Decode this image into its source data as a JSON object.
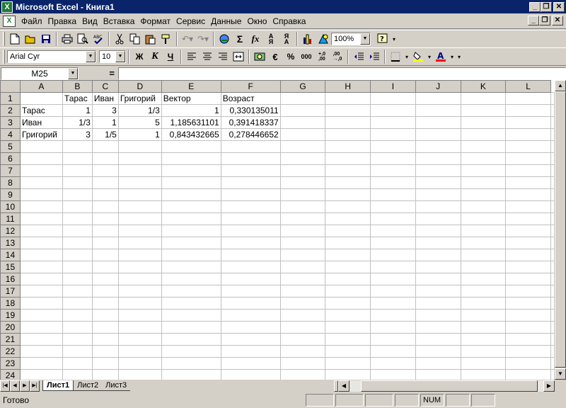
{
  "window": {
    "title": "Microsoft Excel - Книга1",
    "app_icon": "excel-icon",
    "minimize": "_",
    "restore": "❐",
    "close": "✕"
  },
  "menu": {
    "items": [
      "Файл",
      "Правка",
      "Вид",
      "Вставка",
      "Формат",
      "Сервис",
      "Данные",
      "Окно",
      "Справка"
    ]
  },
  "toolbar": {
    "zoom": "100%",
    "font_name": "Arial Cyr",
    "font_size": "10",
    "bold_label": "Ж",
    "italic_label": "К",
    "underline_label": "Ч",
    "percent_label": "%",
    "thousands_label": "000",
    "inc_decimal_label": "+,0 ,00",
    "dec_decimal_label": "→,00 ,0",
    "sigma_label": "Σ",
    "fx_label": "fx",
    "euro_label": "€",
    "font_color": "#ff0000",
    "fill_color": "#ffff00"
  },
  "formula_bar": {
    "cell_ref": "M25",
    "equals": "=",
    "formula": ""
  },
  "sheet": {
    "columns": [
      "A",
      "B",
      "C",
      "D",
      "E",
      "F",
      "G",
      "H",
      "I",
      "J",
      "K",
      "L"
    ],
    "rows": [
      [
        "",
        "Тарас",
        "Иван",
        "Григорий",
        "Вектор",
        "Возраст",
        "",
        "",
        "",
        "",
        "",
        ""
      ],
      [
        "Тарас",
        "1",
        "3",
        "1/3",
        "1",
        "0,330135011",
        "",
        "",
        "",
        "",
        "",
        ""
      ],
      [
        "Иван",
        "1/3",
        "1",
        "5",
        "1,185631101",
        "0,391418337",
        "",
        "",
        "",
        "",
        "",
        ""
      ],
      [
        "Григорий",
        "3",
        "1/5",
        "1",
        "0,843432665",
        "0,278446652",
        "",
        "",
        "",
        "",
        "",
        ""
      ]
    ],
    "row_numbers": [
      "1",
      "2",
      "3",
      "4",
      "5",
      "6",
      "7",
      "8",
      "9",
      "10",
      "11",
      "12",
      "13",
      "14",
      "15",
      "16",
      "17",
      "18",
      "19",
      "20",
      "21",
      "22",
      "23",
      "24"
    ]
  },
  "tabs": {
    "sheets": [
      "Лист1",
      "Лист2",
      "Лист3"
    ],
    "active": "Лист1"
  },
  "status": {
    "text": "Готово",
    "num": "NUM"
  }
}
